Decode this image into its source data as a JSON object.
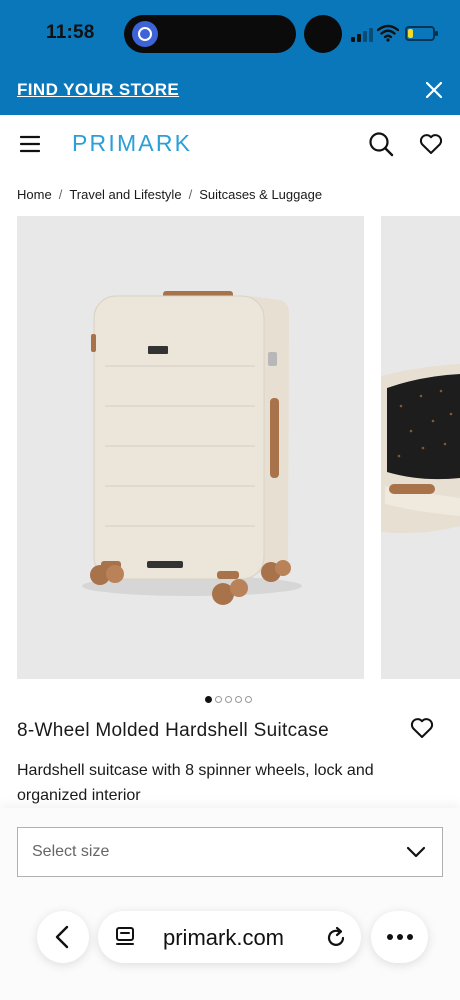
{
  "status_bar": {
    "time": "11:58",
    "battery_level": 0.2,
    "battery_color": "#f2dc2b"
  },
  "banner": {
    "link_label": "FIND YOUR STORE",
    "close_icon": "close-icon",
    "background_color": "#0a77bb"
  },
  "header": {
    "logo": "PRIMARK",
    "logo_color": "#2a9fd8",
    "icons": [
      "menu-icon",
      "search-icon",
      "heart-icon"
    ]
  },
  "breadcrumb": {
    "items": [
      "Home",
      "Travel and Lifestyle",
      "Suitcases & Luggage"
    ],
    "separator": "/"
  },
  "gallery": {
    "image_count": 5,
    "active_index": 0
  },
  "product": {
    "title": "8-Wheel Molded Hardshell Suitcase",
    "description": "Hardshell suitcase with 8 spinner wheels, lock and organized interior"
  },
  "size_select": {
    "placeholder": "Select size"
  },
  "browser": {
    "url": "primark.com",
    "icons": [
      "back-icon",
      "tabs-icon",
      "reload-icon",
      "more-icon"
    ]
  }
}
